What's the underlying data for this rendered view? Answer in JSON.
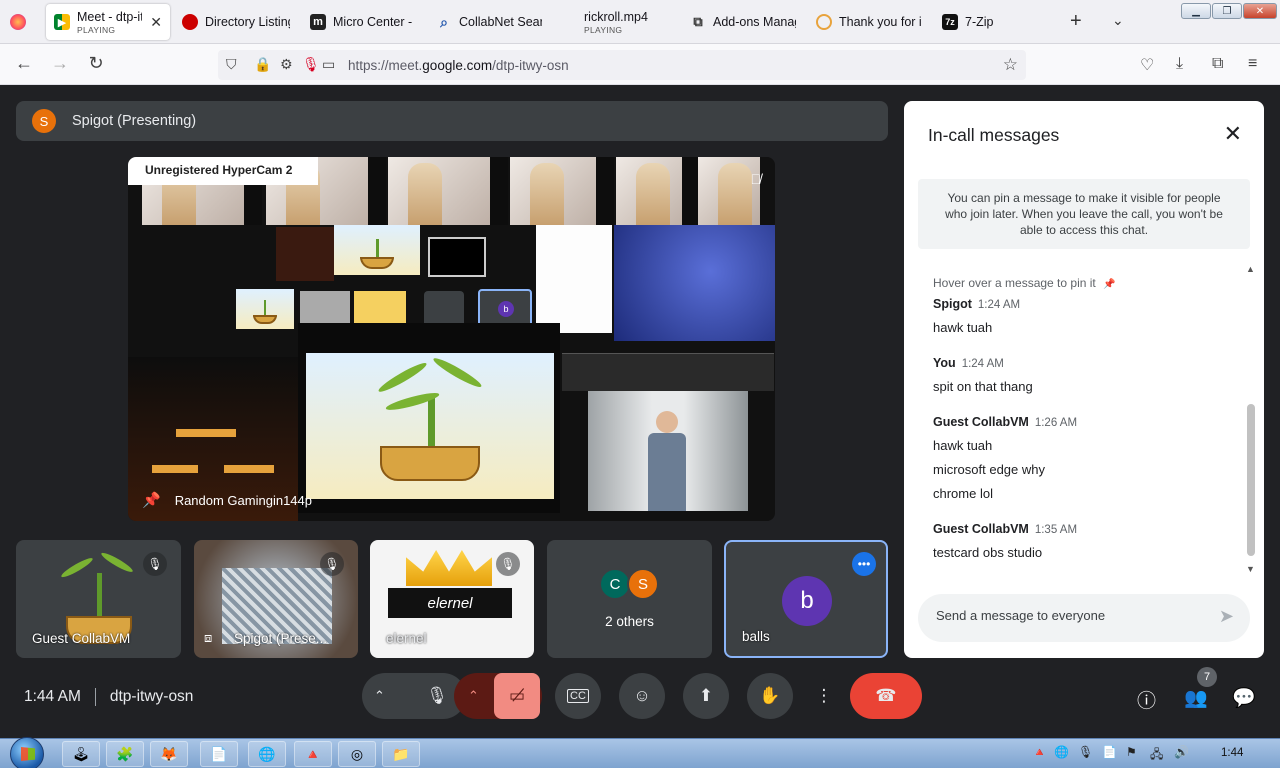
{
  "browser": {
    "tabs": [
      {
        "label": "Meet - dtp-it",
        "sub": "PLAYING",
        "icon": "google-meet-icon",
        "active": true
      },
      {
        "label": "Directory Listing",
        "icon": "red-hat-icon"
      },
      {
        "label": "Micro Center - I",
        "icon": "micro-center-icon"
      },
      {
        "label": "CollabNet Searc",
        "icon": "search-icon"
      },
      {
        "label": "rickroll.mp4",
        "sub": "PLAYING",
        "icon": "video-icon"
      },
      {
        "label": "Add-ons Manag",
        "icon": "puzzle-icon"
      },
      {
        "label": "Thank you for i",
        "icon": "circle-icon"
      },
      {
        "label": "7-Zip",
        "icon": "7zip-icon"
      }
    ],
    "url_prefix": "https://meet.",
    "url_host": "google.com",
    "url_path": "/dtp-itwy-osn"
  },
  "presenter": {
    "initial": "S",
    "title": "Spigot (Presenting)"
  },
  "stage": {
    "watermark": "Unregistered HyperCam 2",
    "caption": "Random Gamingin144p",
    "sub_badge_initial": "b",
    "sub_tag": "elernel"
  },
  "tiles": [
    {
      "name": "Guest CollabVM"
    },
    {
      "name": "Spigot (Prese..."
    },
    {
      "name": "elernel",
      "overlay": "elernel"
    },
    {
      "name": "2 others",
      "avatars": [
        "C",
        "S"
      ]
    },
    {
      "name": "balls",
      "initial": "b"
    }
  ],
  "meeting": {
    "time": "1:44 AM",
    "code": "dtp-itwy-osn",
    "participant_count": "7",
    "warning": "!"
  },
  "chat": {
    "title": "In-call messages",
    "pin_note": "You can pin a message to make it visible for people who join later. When you leave the call, you won't be able to access this chat.",
    "hover_note": "Hover over a message to pin it",
    "messages": [
      {
        "sender": "Spigot",
        "time": "1:24 AM",
        "lines": [
          "hawk tuah"
        ]
      },
      {
        "sender": "You",
        "time": "1:24 AM",
        "lines": [
          "spit on that thang"
        ]
      },
      {
        "sender": "Guest CollabVM",
        "time": "1:26 AM",
        "lines": [
          "hawk tuah",
          "microsoft edge why",
          "chrome lol"
        ]
      },
      {
        "sender": "Guest CollabVM",
        "time": "1:35 AM",
        "lines": [
          "testcard obs studio"
        ]
      }
    ],
    "input_placeholder": "Send a message to everyone"
  },
  "taskbar": {
    "clock": "1:44"
  },
  "colors": {
    "meet_bg": "#202124",
    "tile_bg": "#3c4043",
    "end_call": "#ea4335",
    "accent_blue": "#8ab4f8",
    "avatar_orange": "#e8710a",
    "avatar_teal": "#00695c",
    "avatar_purple": "#5e35b1"
  }
}
